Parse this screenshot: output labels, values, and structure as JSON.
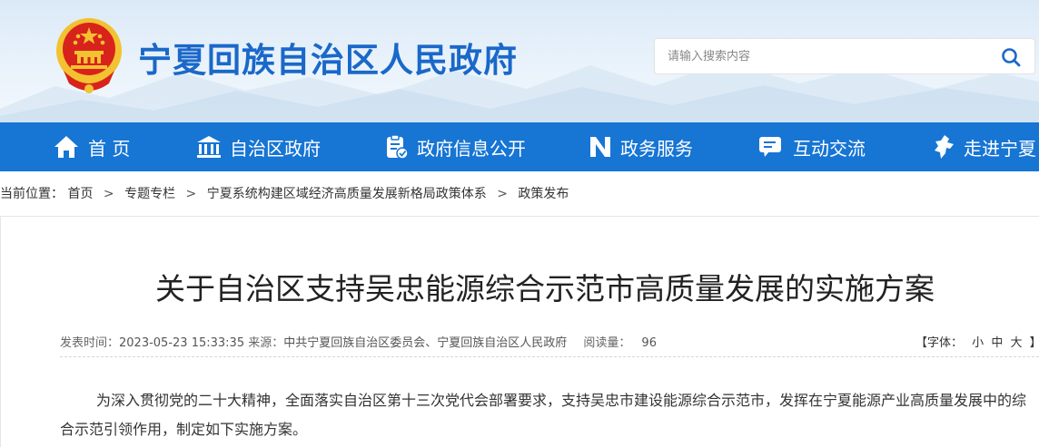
{
  "header": {
    "site_title": "宁夏回族自治区人民政府",
    "search_placeholder": "请输入搜索内容"
  },
  "nav": {
    "items": [
      {
        "label": "首 页",
        "icon": "home-icon"
      },
      {
        "label": "自治区政府",
        "icon": "government-building-icon"
      },
      {
        "label": "政府信息公开",
        "icon": "document-check-icon"
      },
      {
        "label": "政务服务",
        "icon": "service-n-icon"
      },
      {
        "label": "互动交流",
        "icon": "chat-bubble-icon"
      },
      {
        "label": "走进宁夏",
        "icon": "ningxia-map-icon"
      }
    ]
  },
  "breadcrumb": {
    "prefix": "当前位置：",
    "items": [
      "首页",
      "专题专栏",
      "宁夏系统构建区域经济高质量发展新格局政策体系",
      "政策发布"
    ],
    "separator": ">"
  },
  "article": {
    "title": "关于自治区支持吴忠能源综合示范市高质量发展的实施方案",
    "publish_label": "发表时间：",
    "publish_time": "2023-05-23 15:33:35",
    "source_label": "来源：",
    "source": "中共宁夏回族自治区委员会、宁夏回族自治区人民政府",
    "views_label": "阅读量：",
    "views": "96",
    "font_label": "【字体：",
    "font_small": "小",
    "font_medium": "中",
    "font_large": "大",
    "font_close": "】",
    "paragraph": "为深入贯彻党的二十大精神，全面落实自治区第十三次党代会部署要求，支持吴忠市建设能源综合示范市，发挥在宁夏能源产业高质量发展中的综合示范引领作用，制定如下实施方案。"
  },
  "colors": {
    "nav_bg": "#1775d4",
    "title_blue": "#1a68c9",
    "emblem_red": "#d8231c",
    "emblem_gold": "#f2c230"
  }
}
